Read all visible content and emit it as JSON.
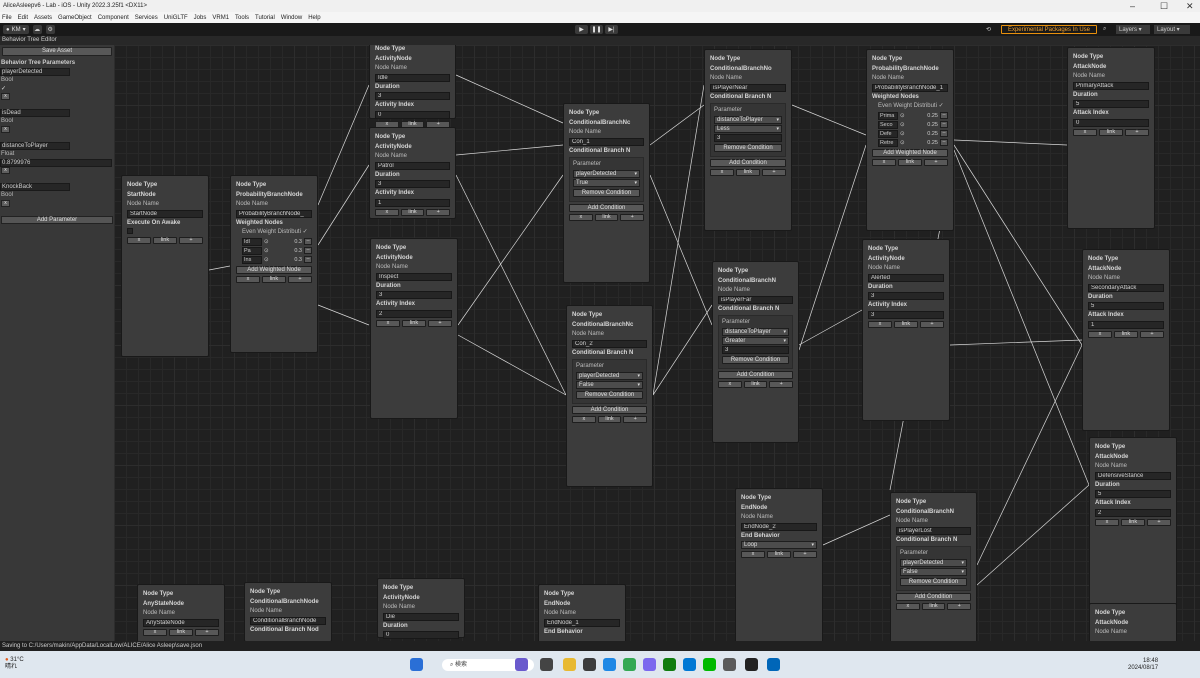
{
  "window": {
    "title": "AliceAsleepv6 - Lab - iOS - Unity 2022.3.25f1 <DX11>"
  },
  "menu": [
    "File",
    "Edit",
    "Assets",
    "GameObject",
    "Component",
    "Services",
    "UniGLTF",
    "Jobs",
    "VRM1",
    "Tools",
    "Tutorial",
    "Window",
    "Help"
  ],
  "toolbar": {
    "account": "KM",
    "experimental": "Experimental Packages In Use",
    "layers": "Layers",
    "layout": "Layout"
  },
  "editor": {
    "title": "Behavior Tree Editor",
    "save": "Save Asset",
    "params_title": "Behavior Tree Parameters",
    "add_param": "Add Parameter",
    "params": [
      {
        "name": "playerDetected",
        "type": "Bool",
        "value": "✓"
      },
      {
        "name": "isDead",
        "type": "Bool",
        "value": ""
      },
      {
        "name": "distanceToPlayer",
        "type": "Float",
        "value": "0.8799976"
      },
      {
        "name": "KnockBack",
        "type": "Bool",
        "value": ""
      }
    ]
  },
  "labels": {
    "node_type": "Node Type",
    "node_name": "Node Name",
    "duration": "Duration",
    "activity_index": "Activity Index",
    "attack_index": "Attack Index",
    "execute": "Execute On Awake",
    "cbranch": "Conditional Branch N",
    "parameter": "Parameter",
    "remove": "Remove Condition",
    "add": "Add Condition",
    "weighted": "Weighted Nodes",
    "even": "Even Weight Distributi",
    "add_weighted": "Add Weighted Node",
    "end_behavior": "End Behavior",
    "x": "x",
    "link": "link",
    "plus": "+"
  },
  "nodes": {
    "start": {
      "type": "StartNode",
      "name": "StartNode"
    },
    "prob0": {
      "type": "ProbabilityBranchNode",
      "name": "ProbabilityBranchNode_",
      "w": [
        [
          "Idl",
          "0.3"
        ],
        [
          "Pa",
          "0.3"
        ],
        [
          "Ins",
          "0.3"
        ]
      ]
    },
    "idle": {
      "type": "ActivityNode",
      "name": "Idle",
      "duration": "3",
      "index": "0"
    },
    "patrol": {
      "type": "ActivityNode",
      "name": "Patrol",
      "duration": "3",
      "index": "1"
    },
    "inspect": {
      "type": "ActivityNode",
      "name": "Inspect",
      "duration": "3",
      "index": "2"
    },
    "con1": {
      "type": "ConditionalBranchNc",
      "name": "Con_1",
      "param": "playerDetected",
      "val": "True"
    },
    "con2": {
      "type": "ConditionalBranchNc",
      "name": "Con_2",
      "param": "playerDetected",
      "val": "False"
    },
    "near": {
      "type": "ConditionalBranchNo",
      "name": "isPlayerNear",
      "param": "distanceToPlayer",
      "op": "Less",
      "val": "3"
    },
    "far": {
      "type": "ConditionalBranchN",
      "name": "isPlayerFar",
      "param": "distanceToPlayer",
      "op": "Greater",
      "val": "3"
    },
    "prob1": {
      "type": "ProbabilityBranchNode",
      "name": "ProbabilityBranchNode_1",
      "w": [
        [
          "Prima",
          "0.25"
        ],
        [
          "Seco",
          "0.25"
        ],
        [
          "Defe",
          "0.25"
        ],
        [
          "Retre",
          "0.25"
        ]
      ]
    },
    "alerted": {
      "type": "ActivityNode",
      "name": "Alerted",
      "duration": "3",
      "index": "3"
    },
    "primary": {
      "type": "AttackNode",
      "name": "PrimaryAttack",
      "duration": "5",
      "index": "0"
    },
    "secondary": {
      "type": "AttackNode",
      "name": "SecondaryAttack",
      "duration": "5",
      "index": "1"
    },
    "defensive": {
      "type": "AttackNode",
      "name": "DefensiveStance",
      "duration": "5",
      "index": "2"
    },
    "attack4": {
      "type": "AttackNode"
    },
    "end2": {
      "type": "EndNode",
      "name": "EndNode_2",
      "behavior": "Loop"
    },
    "lost": {
      "type": "ConditionalBranchN",
      "name": "isPlayerLost",
      "param": "playerDetected",
      "val": "False"
    },
    "any": {
      "type": "AnyStateNode",
      "name": "AnyStateNode"
    },
    "cbn": {
      "type": "ConditionalBranchNode",
      "name": "ConditionalBranchNode",
      "extra": "Conditional Branch Nod"
    },
    "die": {
      "type": "ActivityNode",
      "name": "Die",
      "duration": "0"
    },
    "end1": {
      "type": "EndNode",
      "name": "EndNode_1"
    }
  },
  "status": "Saving to C:/Users/makin/AppData/LocalLow/ALICE/Alice Asleep\\save.json",
  "taskbar": {
    "weather_temp": "31°C",
    "weather_desc": "晴れ",
    "search": "検索",
    "time": "18:48",
    "date": "2024/08/17"
  }
}
